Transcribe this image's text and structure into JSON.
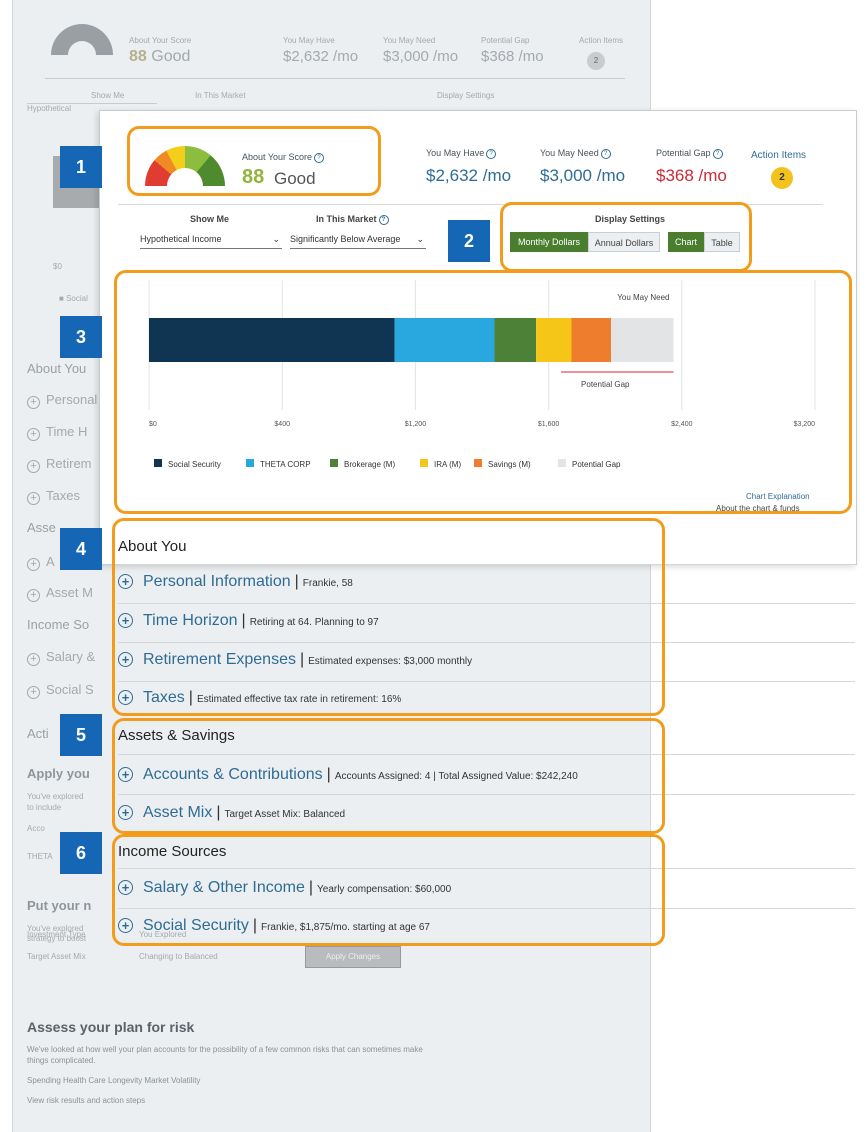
{
  "background": {
    "score_label": "About Your Score",
    "score_value": "88",
    "score_word": "Good",
    "may_have_label": "You May Have",
    "may_have": "$2,632 /mo",
    "may_need_label": "You May Need",
    "may_need": "$3,000 /mo",
    "gap_label": "Potential Gap",
    "gap": "$368 /mo",
    "action_label": "Action Items",
    "action_count": "2",
    "show_me": "Show Me",
    "market": "In This Market",
    "display": "Display Settings",
    "hypothetical": "Hypothetical",
    "axis_zero": "$0",
    "legend_social": "Social",
    "about_you": "About You",
    "personal": "Personal",
    "time_h": "Time H",
    "retirem": "Retirem",
    "taxes": "Taxes",
    "assets": "Asse",
    "a_item": "A",
    "asset_m": "Asset M",
    "income_so": "Income So",
    "salary": "Salary &",
    "social": "Social S",
    "action_title": "Acti",
    "apply_you": "Apply you",
    "explored_1": "You've explored",
    "explored_2": "to include",
    "acco": "Acco",
    "theta": "THETA",
    "put_your": "Put your n",
    "explored_3": "You've explored",
    "explored_4": "strategy to boost",
    "investment_type": "Investment Type",
    "you_explored": "You Explored",
    "target_asset_mix": "Target Asset Mix",
    "changing_to": "Changing to Balanced",
    "apply_changes": "Apply Changes",
    "risk_title": "Assess your plan for risk",
    "risk_text_1": "We've looked at how well your plan accounts for the possibility of a few common risks that can sometimes make",
    "risk_text_2": "things complicated.",
    "risk_items": "Spending   Health Care   Longevity   Market Volatility",
    "risk_link": "View risk results and action steps"
  },
  "score": {
    "label": "About Your Score",
    "value": "88",
    "word": "Good"
  },
  "summary": {
    "may_have_label": "You May Have",
    "may_have": "$2,632 /mo",
    "may_need_label": "You May Need",
    "may_need": "$3,000 /mo",
    "gap_label": "Potential Gap",
    "gap": "$368 /mo",
    "action_label": "Action Items",
    "action_count": "2"
  },
  "controls": {
    "show_me_label": "Show Me",
    "show_me_value": "Hypothetical Income",
    "market_label": "In This Market",
    "market_value": "Significantly Below Average",
    "display_label": "Display Settings",
    "monthly": "Monthly Dollars",
    "annual": "Annual Dollars",
    "chart": "Chart",
    "table": "Table"
  },
  "chart_data": {
    "type": "bar",
    "orientation": "horizontal-stacked",
    "categories": [
      "Income"
    ],
    "series": [
      {
        "name": "Social Security",
        "values": [
          1180
        ],
        "color": "#0f3552"
      },
      {
        "name": "THETA CORP",
        "values": [
          480
        ],
        "color": "#29a8df"
      },
      {
        "name": "Brokerage (M)",
        "values": [
          200
        ],
        "color": "#4d8137"
      },
      {
        "name": "IRA (M)",
        "values": [
          170
        ],
        "color": "#f5c518"
      },
      {
        "name": "Savings (M)",
        "values": [
          190
        ],
        "color": "#ee7d2d"
      },
      {
        "name": "Potential Gap",
        "values": [
          300
        ],
        "color": "#e3e4e5"
      }
    ],
    "x_ticks": [
      "$0",
      "$400",
      "$1,200",
      "$1,600",
      "$2,400",
      "$3,200"
    ],
    "xlim": [
      0,
      3200
    ],
    "annotations": [
      "You May Need",
      "Potential Gap"
    ],
    "legend_position": "bottom",
    "grid": true
  },
  "chart_links": {
    "explanation": "Chart Explanation",
    "sub": "About the chart & funds"
  },
  "about_you": {
    "title": "About You",
    "items": [
      {
        "label": "Personal Information",
        "detail": "Frankie, 58"
      },
      {
        "label": "Time Horizon",
        "detail": "Retiring at 64. Planning to 97"
      },
      {
        "label": "Retirement Expenses",
        "detail": "Estimated expenses: $3,000 monthly"
      },
      {
        "label": "Taxes",
        "detail": "Estimated effective tax rate in retirement: 16%"
      }
    ]
  },
  "assets": {
    "title": "Assets & Savings",
    "items": [
      {
        "label": "Accounts & Contributions",
        "detail": "Accounts Assigned: 4 | Total Assigned Value: $242,240"
      },
      {
        "label": "Asset Mix",
        "detail": "Target Asset Mix: Balanced"
      }
    ]
  },
  "income": {
    "title": "Income Sources",
    "items": [
      {
        "label": "Salary & Other Income",
        "detail": "Yearly compensation: $60,000"
      },
      {
        "label": "Social Security",
        "detail": "Frankie, $1,875/mo. starting at age 67"
      }
    ]
  },
  "callouts": [
    "1",
    "2",
    "3",
    "4",
    "5",
    "6"
  ],
  "separator": "|"
}
